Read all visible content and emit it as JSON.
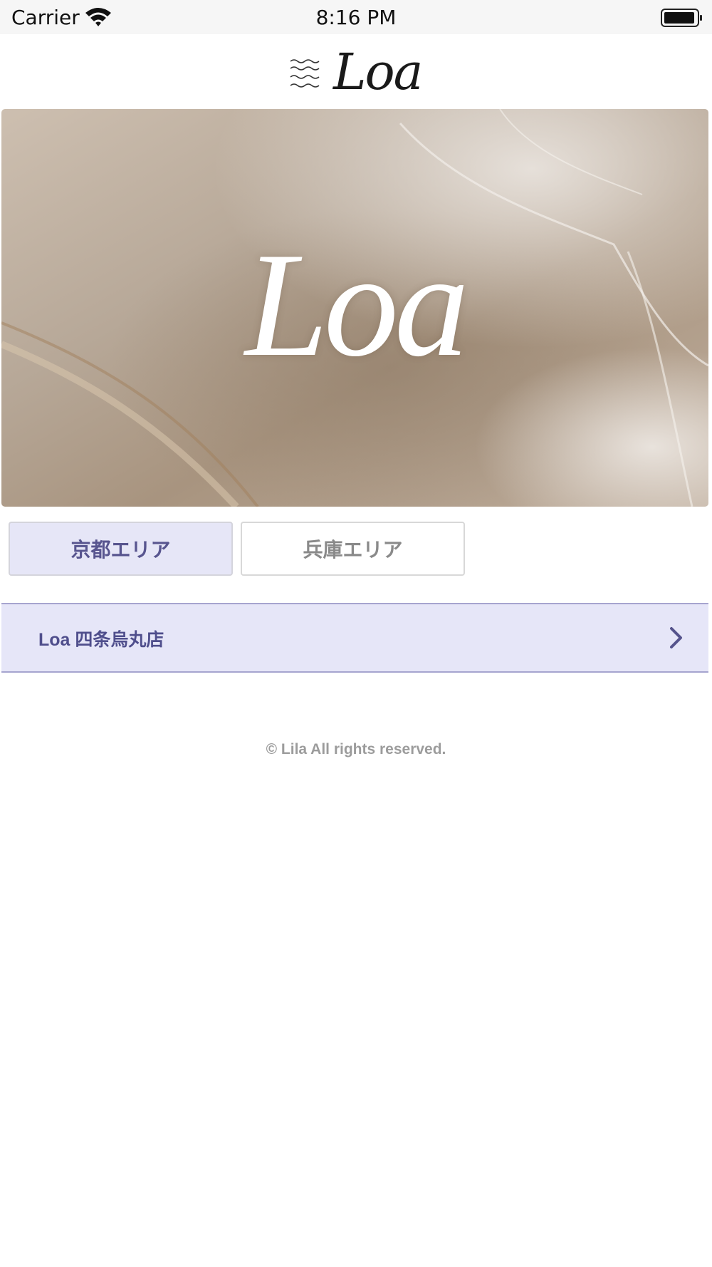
{
  "status_bar": {
    "carrier": "Carrier",
    "time": "8:16 PM",
    "icons": [
      "wifi-icon",
      "battery-icon"
    ]
  },
  "header": {
    "logo_text": "Loa",
    "logo_icon": "waves-icon"
  },
  "hero": {
    "title": "Loa"
  },
  "area_tabs": [
    {
      "label": "京都エリア",
      "selected": true
    },
    {
      "label": "兵庫エリア",
      "selected": false
    }
  ],
  "stores": [
    {
      "name": "Loa 四条烏丸店",
      "icon": "chevron-right-icon"
    }
  ],
  "footer": {
    "copyright": "© Lila All rights reserved."
  },
  "colors": {
    "accent": "#58558f",
    "selected_bg": "#e6e6f7",
    "row_border": "#a6a5cf",
    "status_bar_bg": "#f6f6f6"
  }
}
